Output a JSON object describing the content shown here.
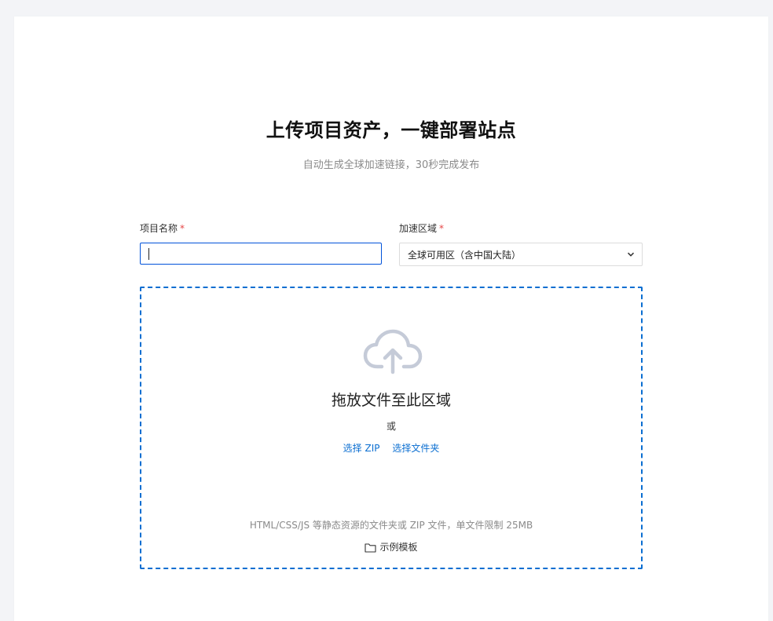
{
  "header": {
    "title": "上传项目资产，一键部署站点",
    "subtitle": "自动生成全球加速链接，30秒完成发布"
  },
  "form": {
    "name_label": "项目名称",
    "name_value": "",
    "region_label": "加速区域",
    "region_value": "全球可用区（含中国大陆）",
    "required_mark": "*"
  },
  "upload": {
    "icon": "cloud-upload-icon",
    "title": "拖放文件至此区域",
    "or": "或",
    "select_zip": "选择 ZIP",
    "select_folder": "选择文件夹",
    "hint": "HTML/CSS/JS 等静态资源的文件夹或 ZIP 文件，单文件限制 25MB",
    "template_label": "示例模板",
    "template_icon": "folder-icon"
  },
  "colors": {
    "accent": "#0a6ed1",
    "required": "#e54545",
    "background": "#f3f4f7"
  }
}
